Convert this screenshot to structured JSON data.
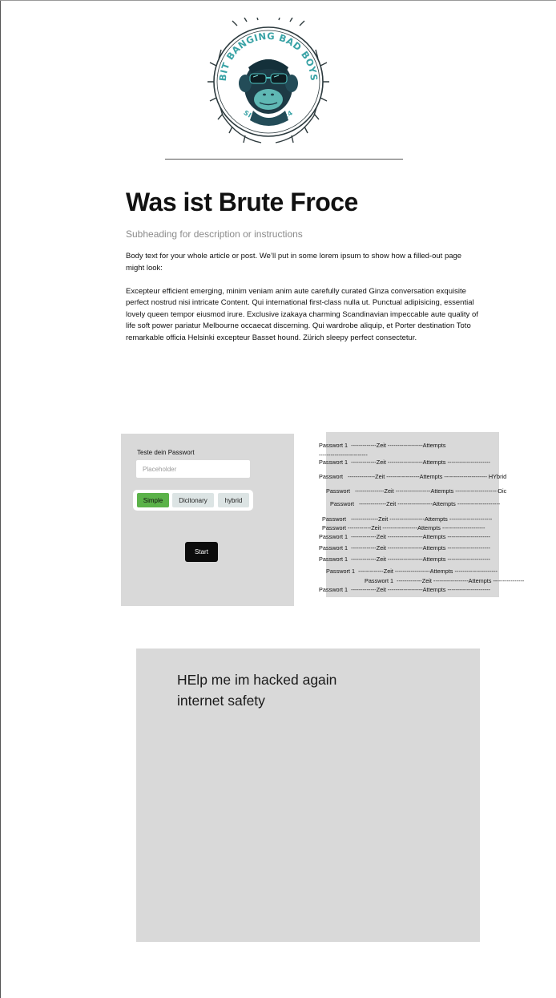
{
  "logo": {
    "arc_text_top": "BIT BANGING BAD BOYS",
    "arc_text_bottom": "SINCE - 2024",
    "icon": "monkey-with-sunglasses-badge"
  },
  "article": {
    "title": "Was ist Brute Froce",
    "subtitle": "Subheading for description or instructions",
    "paragraph1": "Body text for your whole article or post. We’ll put in some lorem ipsum to show how a filled-out page might look:",
    "paragraph2": "Excepteur efficient emerging, minim veniam anim aute carefully curated Ginza conversation exquisite perfect nostrud nisi intricate Content. Qui  international first-class nulla ut. Punctual adipisicing, essential lovely queen tempor eiusmod irure. Exclusive izakaya charming Scandinavian impeccable aute quality of life soft power pariatur Melbourne occaecat discerning. Qui wardrobe aliquip, et Porter destination Toto remarkable officia Helsinki excepteur Basset hound. Zürich sleepy perfect consectetur."
  },
  "password_test": {
    "label": "Teste dein Passwort",
    "input_value": "",
    "input_placeholder": "Placeholder",
    "modes": {
      "simple": "Simple",
      "dictionary": "Dicitonary",
      "hybrid": "hybrid"
    },
    "selected_mode": "Simple",
    "start_label": "Start"
  },
  "results": [
    "Passwort 1  -------------Zeit ------------------Attempts",
    "-------------------------",
    "Passwort 1  -------------Zeit ------------------Attempts ----------------------",
    "Passwort   --------------Zeit -----------------Attempts ---------------------- HYbrid",
    "Passwort   ---------------Zeit ------------------Attempts ----------------------Dic",
    "Passwort   --------------Zeit ------------------Attempts ----------------------",
    "Passwort   --------------Zeit ------------------Attempts ----------------------",
    "Passwort ------------Zeit ------------------Attempts ----------------------",
    "Passwort 1  -------------Zeit ------------------Attempts ----------------------",
    "Passwort 1  -------------Zeit ------------------Attempts ----------------------",
    "Passwort 1  -------------Zeit ------------------Attempts ----------------------",
    "Passwort 1  -------------Zeit ------------------Attempts ----------------------",
    "Passwort 1  -------------Zeit ------------------Attempts ----------------",
    "Passwort 1  -------------Zeit ------------------Attempts ----------------------"
  ],
  "help": {
    "line1": "HElp me im hacked again",
    "line2": "internet safety"
  },
  "colors": {
    "panel_bg": "#d9d9d9",
    "selected_mode": "#5bb249",
    "mode_inactive": "#dce4e4",
    "start_button": "#0c0c0c",
    "logo_teal": "#3aa3a6",
    "logo_dark": "#1d3a45"
  }
}
